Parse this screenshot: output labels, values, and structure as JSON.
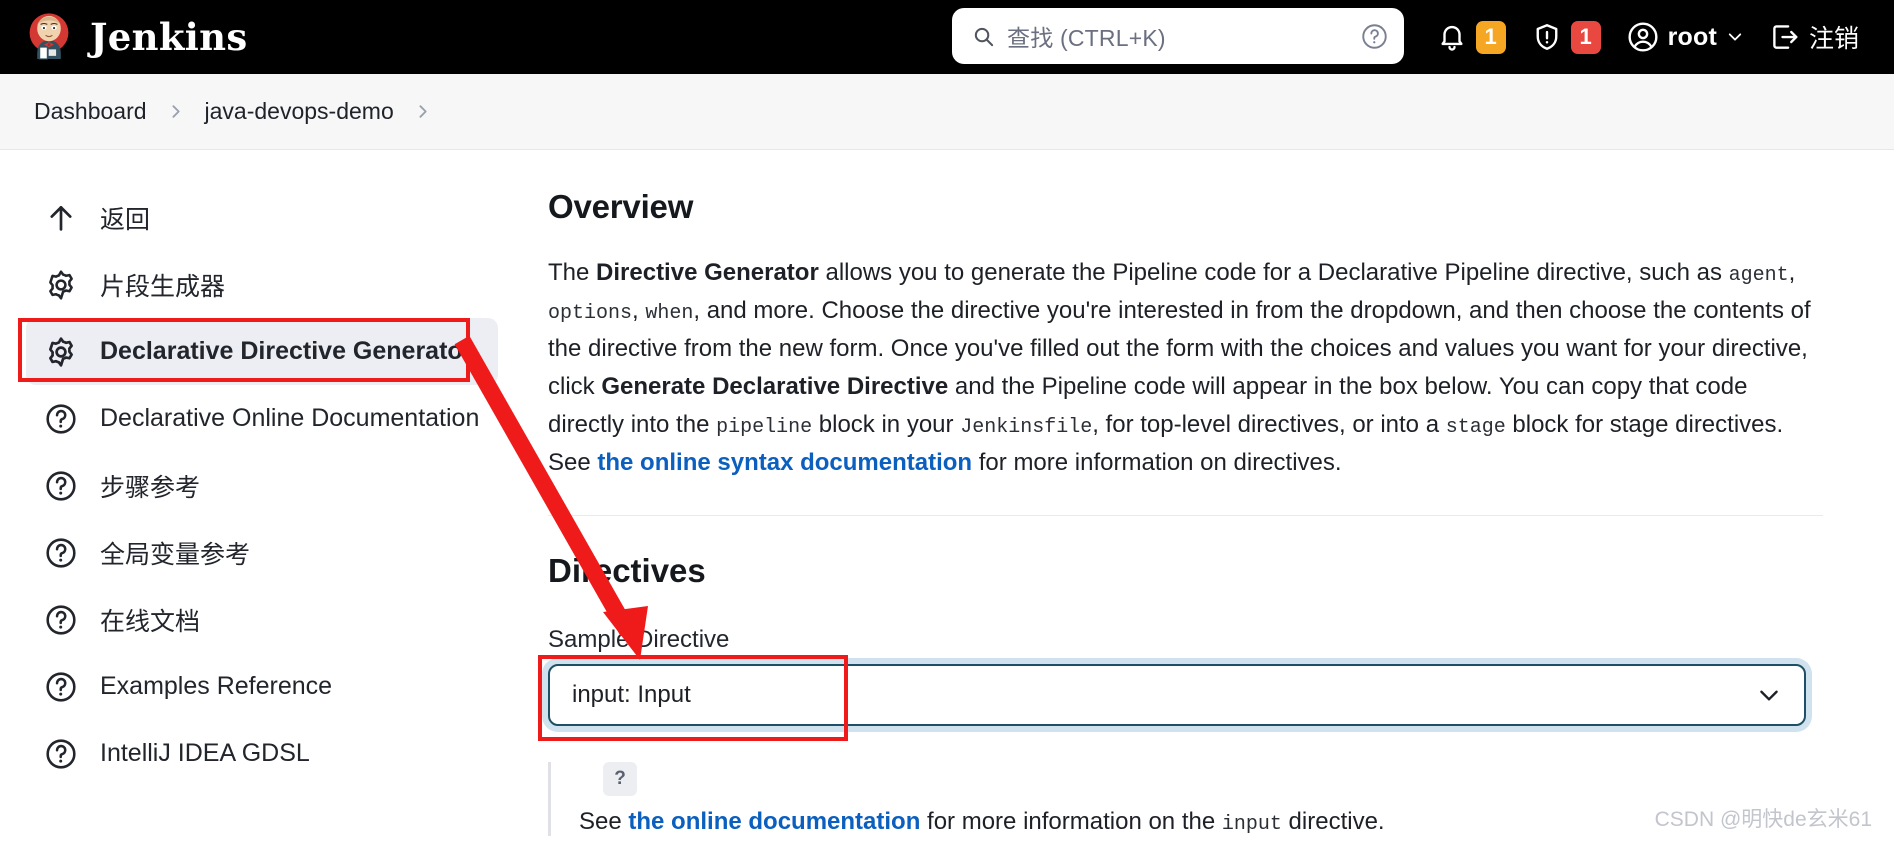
{
  "header": {
    "brand": "Jenkins",
    "brand_icon": "jenkins-butler-logo",
    "search": {
      "icon": "search-icon",
      "placeholder": "查找 (CTRL+K)",
      "help_icon": "help-circle-icon"
    },
    "notifications": {
      "icon": "bell-icon",
      "count": "1",
      "color": "#f5a623"
    },
    "security": {
      "icon": "shield-exclamation-icon",
      "count": "1",
      "color": "#e8483f"
    },
    "user": {
      "icon": "user-circle-icon",
      "name": "root",
      "caret": "chevron-down-icon"
    },
    "logout": {
      "icon": "logout-icon",
      "label": "注销"
    }
  },
  "breadcrumb": {
    "items": [
      {
        "label": "Dashboard"
      },
      {
        "label": "java-devops-demo"
      }
    ],
    "separator_icon": "chevron-right-icon"
  },
  "sidebar": {
    "items": [
      {
        "label": "返回",
        "icon": "arrow-up-icon",
        "active": false
      },
      {
        "label": "片段生成器",
        "icon": "gear-icon",
        "active": false
      },
      {
        "label": "Declarative Directive Generator",
        "icon": "gear-icon",
        "active": true
      },
      {
        "label": "Declarative Online Documentation",
        "icon": "help-circle-icon",
        "active": false
      },
      {
        "label": "步骤参考",
        "icon": "help-circle-icon",
        "active": false
      },
      {
        "label": "全局变量参考",
        "icon": "help-circle-icon",
        "active": false
      },
      {
        "label": "在线文档",
        "icon": "help-circle-icon",
        "active": false
      },
      {
        "label": "Examples Reference",
        "icon": "help-circle-icon",
        "active": false
      },
      {
        "label": "IntelliJ IDEA GDSL",
        "icon": "help-circle-icon",
        "active": false
      }
    ]
  },
  "main": {
    "overview_heading": "Overview",
    "overview_paragraph": {
      "t1": "The ",
      "b1": "Directive Generator",
      "t2": " allows you to generate the Pipeline code for a Declarative Pipeline directive, such as ",
      "c1": "agent",
      "t3": ", ",
      "c2": "options",
      "t4": ", ",
      "c3": "when",
      "t5": ", and more. Choose the directive you're interested in from the dropdown, and then choose the contents of the directive from the new form. Once you've filled out the form with the choices and values you want for your directive, click ",
      "b2": "Generate Declarative Directive",
      "t6": " and the Pipeline code will appear in the box below. You can copy that code directly into the ",
      "c4": "pipeline",
      "t7": " block in your ",
      "c5": "Jenkinsfile",
      "t8": ", for top-level directives, or into a ",
      "c6": "stage",
      "t9": " block for stage directives. See ",
      "link1": "the online syntax documentation",
      "t10": " for more information on directives."
    },
    "directives_heading": "Directives",
    "sample_directive_label": "Sample Directive",
    "sample_directive_value": "input: Input",
    "sample_directive_caret": "chevron-down-icon",
    "help": {
      "badge": "?",
      "t1": "See ",
      "link": "the online documentation",
      "t2": " for more information on the ",
      "code": "input",
      "t3": " directive."
    }
  },
  "watermark": "CSDN @明快de玄米61",
  "annotations": {
    "accent": "#ef1b1b",
    "highlight_sidebar": "Declarative Directive Generator",
    "highlight_select": "input: Input"
  }
}
